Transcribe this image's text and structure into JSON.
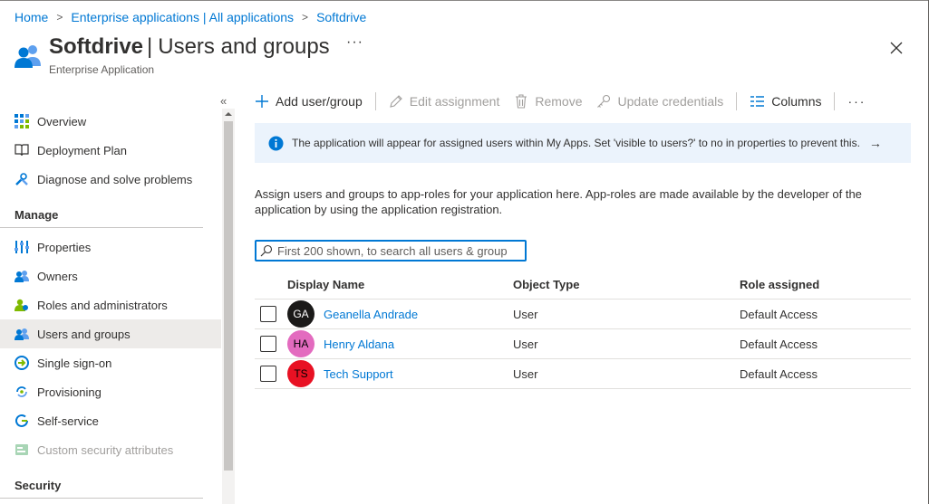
{
  "breadcrumb": {
    "items": [
      "Home",
      "Enterprise applications | All applications",
      "Softdrive"
    ],
    "separator": ">"
  },
  "header": {
    "app_name": "Softdrive",
    "pipe": "|",
    "section": "Users and groups",
    "subtitle": "Enterprise Application",
    "more": "···"
  },
  "sidebar": {
    "collapse": "«",
    "items": [
      {
        "label": "Overview",
        "icon": "overview-grid-icon"
      },
      {
        "label": "Deployment Plan",
        "icon": "book-icon"
      },
      {
        "label": "Diagnose and solve problems",
        "icon": "wrench-icon"
      }
    ],
    "manage_header": "Manage",
    "manage_items": [
      {
        "label": "Properties",
        "icon": "properties-icon"
      },
      {
        "label": "Owners",
        "icon": "owners-icon"
      },
      {
        "label": "Roles and administrators",
        "icon": "roles-icon"
      },
      {
        "label": "Users and groups",
        "icon": "users-icon",
        "active": true
      },
      {
        "label": "Single sign-on",
        "icon": "sso-icon"
      },
      {
        "label": "Provisioning",
        "icon": "provisioning-icon"
      },
      {
        "label": "Self-service",
        "icon": "self-service-icon"
      },
      {
        "label": "Custom security attributes",
        "icon": "custom-attributes-icon",
        "disabled": true
      }
    ],
    "security_header": "Security"
  },
  "toolbar": {
    "add": "Add user/group",
    "edit": "Edit assignment",
    "remove": "Remove",
    "update": "Update credentials",
    "columns": "Columns",
    "more": "···"
  },
  "info": {
    "text": "The application will appear for assigned users within My Apps. Set 'visible to users?' to no in properties to prevent this.",
    "arrow": "→"
  },
  "description": "Assign users and groups to app-roles for your application here. App-roles are made available by the developer of the application by using the application registration.",
  "search": {
    "placeholder": "First 200 shown, to search all users & group"
  },
  "table": {
    "headers": [
      "Display Name",
      "Object Type",
      "Role assigned"
    ],
    "rows": [
      {
        "initials": "GA",
        "name": "Geanella Andrade",
        "type": "User",
        "role": "Default Access",
        "color": "#1b1a19"
      },
      {
        "initials": "HA",
        "name": "Henry Aldana",
        "type": "User",
        "role": "Default Access",
        "color": "#e36bbf"
      },
      {
        "initials": "TS",
        "name": "Tech Support",
        "type": "User",
        "role": "Default Access",
        "color": "#e81123"
      }
    ]
  },
  "colors": {
    "accent": "#0078d4",
    "info_bg": "#ebf3fc",
    "active_nav": "#edebe9"
  }
}
